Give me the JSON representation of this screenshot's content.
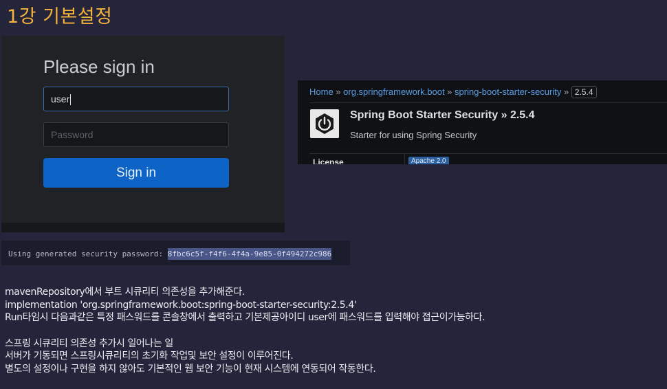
{
  "page": {
    "title": "1강 기본설정"
  },
  "login": {
    "heading": "Please sign in",
    "username_value": "user",
    "password_placeholder": "Password",
    "signin_label": "Sign in"
  },
  "maven": {
    "breadcrumb": {
      "home": "Home",
      "sep": " » ",
      "group": "org.springframework.boot",
      "artifact": "spring-boot-starter-security",
      "version": "2.5.4"
    },
    "title": "Spring Boot Starter Security » 2.5.4",
    "description": "Starter for using Spring Security",
    "license_label": "License",
    "license_value": "Apache 2.0",
    "logo_icon": "power-icon"
  },
  "console": {
    "label": "Using generated security password: ",
    "password": "8fbc6c5f-f4f6-4f4a-9e85-0f494272c986"
  },
  "notes": {
    "line1": "mavenRepository에서 부트 시큐리티 의존성을 추가해준다.",
    "line2": "implementation 'org.springframework.boot:spring-boot-starter-security:2.5.4'",
    "line3": "Run타임시 다음과같은 특정 패스워드를 콘솔창에서 출력하고 기본제공아이디 user에 패스워드를 입력해야 접근이가능하다.",
    "line4": "스프링 시큐리티 의존성 추가시 일어나는 일",
    "line5": "서버가 기동되면 스프링시큐리티의 초기화 작업및 보안 설정이 이루어진다.",
    "line6": "별도의 설정이나 구현을 하지 않아도 기본적인 웹 보안 기능이 현재 시스템에 연동되어 작동한다."
  },
  "colors": {
    "background": "#24243a",
    "title": "#f3b33d",
    "button": "#0e64c6",
    "link": "#5a9ee8"
  }
}
